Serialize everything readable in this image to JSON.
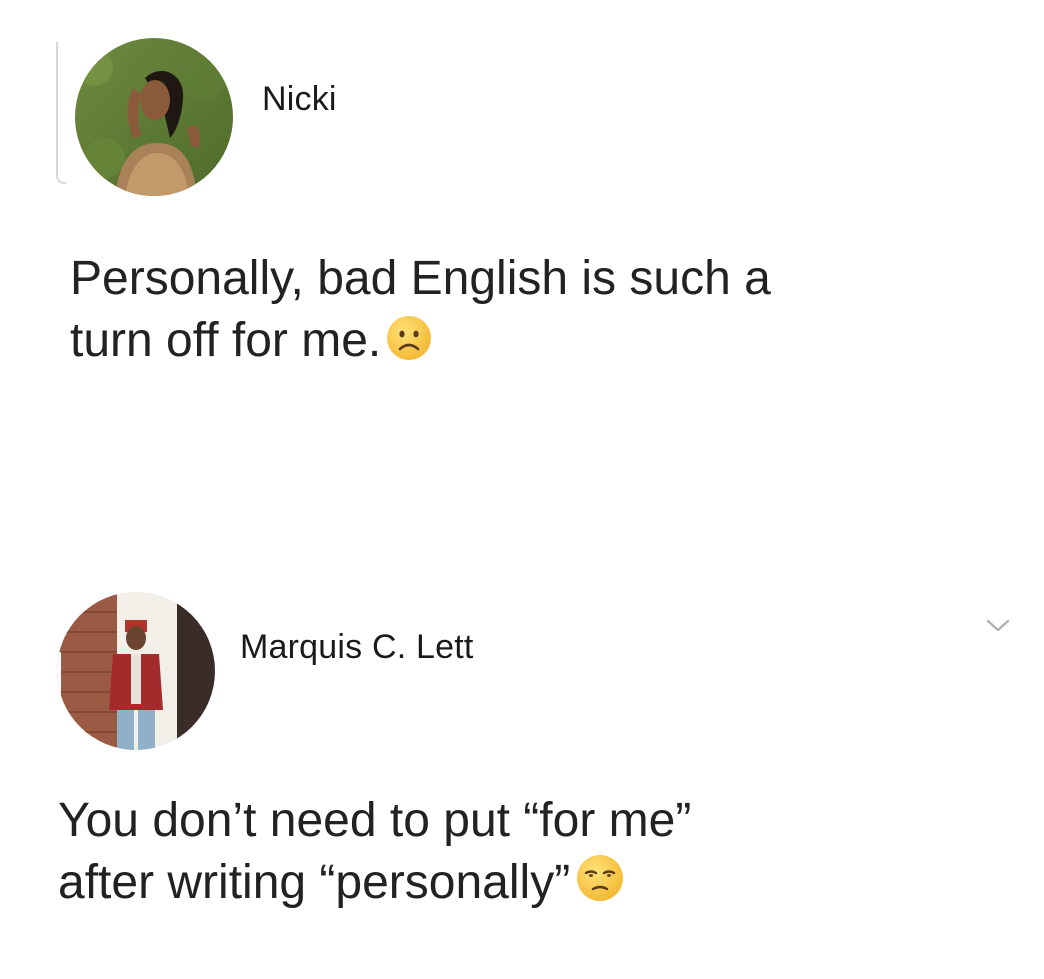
{
  "posts": [
    {
      "author": "Nicki",
      "text_line1": "Personally, bad English is such a",
      "text_line2": "turn off for me.",
      "emoji": "frowning-face-emoji"
    },
    {
      "author": "Marquis C. Lett",
      "text_line1": "You don’t need to put “for me”",
      "text_line2": "after writing “personally”",
      "emoji": "unamused-face-emoji"
    }
  ],
  "colors": {
    "background": "#ffffff",
    "text": "#222222",
    "emoji_yellow": "#f7c74a",
    "chevron": "#b0b0b0"
  },
  "icons": {
    "more_options": "chevron-down-icon"
  }
}
